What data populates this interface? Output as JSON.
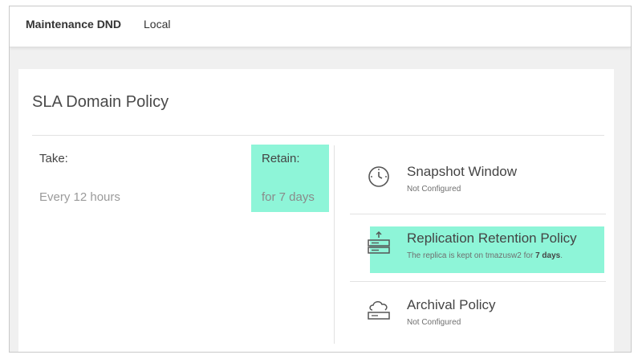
{
  "header": {
    "name": "Maintenance DND",
    "location": "Local"
  },
  "card": {
    "title": "SLA Domain Policy"
  },
  "take": {
    "label": "Take:",
    "value": "Every 12 hours"
  },
  "retain": {
    "label": "Retain:",
    "value": "for 7 days"
  },
  "policies": [
    {
      "title": "Snapshot Window",
      "subtitle": "Not Configured",
      "icon": "clock-icon"
    },
    {
      "title": "Replication Retention Policy",
      "subtitle_prefix": "The replica is kept on tmazusw2 for ",
      "subtitle_bold": "7 days",
      "subtitle_suffix": ".",
      "icon": "server-upload-icon"
    },
    {
      "title": "Archival Policy",
      "subtitle": "Not Configured",
      "icon": "cloud-archive-icon"
    }
  ],
  "colors": {
    "highlight": "#8ef5d8",
    "icon_stroke": "#555555"
  }
}
